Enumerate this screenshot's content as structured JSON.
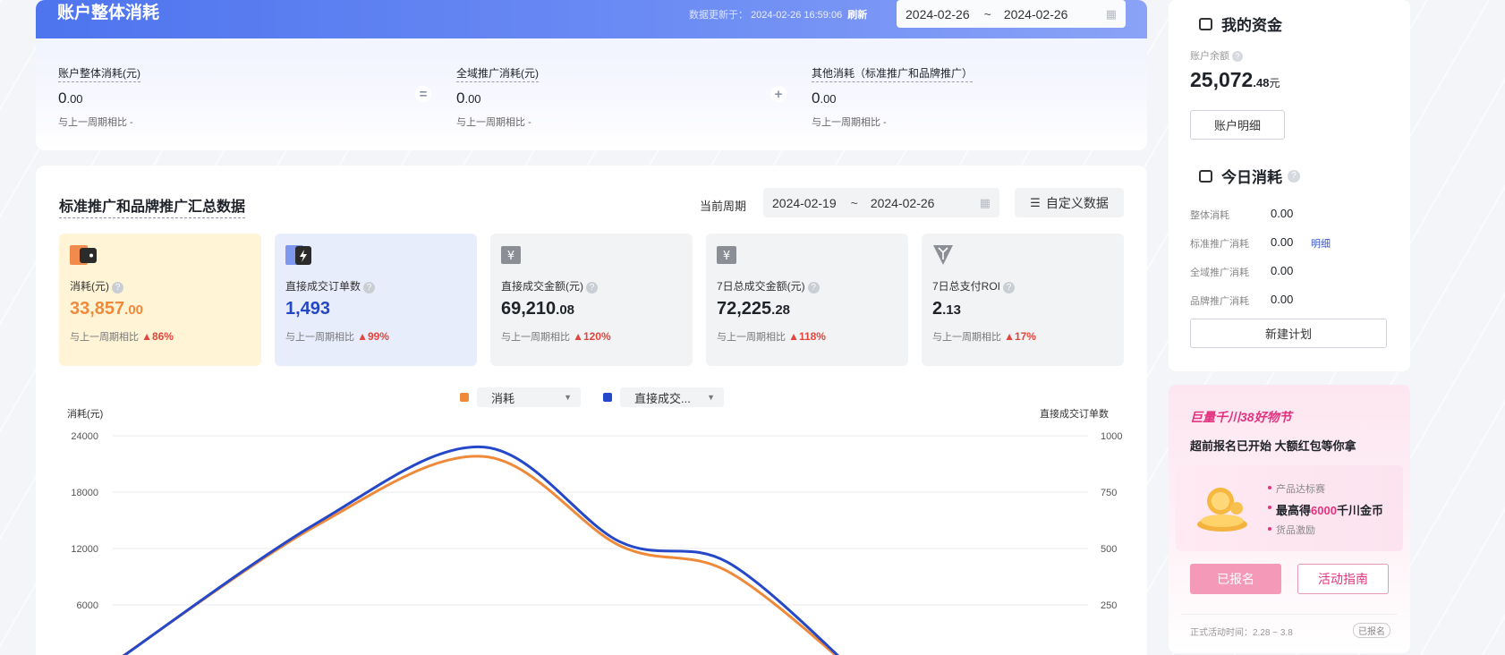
{
  "overall": {
    "title": "账户整体消耗",
    "update_prefix": "数据更新于：",
    "update_time": "2024-02-26 16:59:06",
    "refresh_label": "刷新",
    "date_start": "2024-02-26",
    "date_sep": "~",
    "date_end": "2024-02-26",
    "equals_op": "=",
    "plus_op": "+",
    "metrics": [
      {
        "label": "账户整体消耗(元)",
        "int": "0",
        "dec": ".00",
        "compare": "与上一周期相比 -"
      },
      {
        "label": "全域推广消耗(元)",
        "int": "0",
        "dec": ".00",
        "compare": "与上一周期相比 -"
      },
      {
        "label": "其他消耗（标准推广和品牌推广）",
        "int": "0",
        "dec": ".00",
        "compare": "与上一周期相比 -"
      }
    ]
  },
  "summary": {
    "title": "标准推广和品牌推广汇总数据",
    "period_label": "当前周期",
    "date_start": "2024-02-19",
    "date_sep": "~",
    "date_end": "2024-02-26",
    "custom_label": "自定义数据",
    "kpis": [
      {
        "label": "消耗(元)",
        "int": "33,857",
        "dec": ".00",
        "compare": "与上一周期相比",
        "change": "▲86%"
      },
      {
        "label": "直接成交订单数",
        "int": "1,493",
        "dec": "",
        "compare": "与上一周期相比",
        "change": "▲99%"
      },
      {
        "label": "直接成交金额(元)",
        "int": "69,210",
        "dec": ".08",
        "compare": "与上一周期相比",
        "change": "▲120%"
      },
      {
        "label": "7日总成交金额(元)",
        "int": "72,225",
        "dec": ".28",
        "compare": "与上一周期相比",
        "change": "▲118%"
      },
      {
        "label": "7日总支付ROI",
        "int": "2",
        "dec": ".13",
        "compare": "与上一周期相比",
        "change": "▲17%"
      }
    ],
    "legend": [
      {
        "label": "消耗",
        "color": "#ef8a3a"
      },
      {
        "label": "直接成交...",
        "color": "#2548c9"
      }
    ]
  },
  "chart_data": {
    "type": "line",
    "left_axis_label": "消耗(元)",
    "right_axis_label": "直接成交订单数",
    "left_ticks": [
      "24000",
      "18000",
      "12000",
      "6000"
    ],
    "right_ticks": [
      "1000",
      "750",
      "500",
      "250"
    ],
    "left_ylim": [
      0,
      24000
    ],
    "right_ylim": [
      0,
      1000
    ],
    "grid": true,
    "series": [
      {
        "name": "消耗",
        "axis": "left",
        "color": "#ef8a3a",
        "points": [
          [
            0,
            -200
          ],
          [
            0.21,
            14500
          ],
          [
            0.38,
            21800
          ],
          [
            0.52,
            12300
          ],
          [
            0.63,
            9600
          ],
          [
            0.76,
            -1000
          ]
        ]
      },
      {
        "name": "直接成交...",
        "axis": "right",
        "color": "#2548c9",
        "points": [
          [
            0,
            -10
          ],
          [
            0.21,
            615
          ],
          [
            0.38,
            950
          ],
          [
            0.52,
            530
          ],
          [
            0.63,
            440
          ],
          [
            0.76,
            -40
          ]
        ]
      }
    ]
  },
  "sidebar": {
    "funds_title": "我的资金",
    "balance_label": "账户余额",
    "balance_int": "25,072",
    "balance_dec": ".48",
    "balance_unit": "元",
    "account_detail_btn": "账户明细",
    "today_title": "今日消耗",
    "today_rows": [
      {
        "label": "整体消耗",
        "value": "0.00"
      },
      {
        "label": "标准推广消耗",
        "value": "0.00",
        "link": "明细"
      },
      {
        "label": "全域推广消耗",
        "value": "0.00"
      },
      {
        "label": "品牌推广消耗",
        "value": "0.00"
      }
    ],
    "new_plan_btn": "新建计划"
  },
  "promo": {
    "title": "巨量千川38好物节",
    "subtitle": "超前报名已开始 大额红包等你拿",
    "bullet1": "产品达标赛",
    "bullet2_prefix": "最高得",
    "bullet2_highlight": "6000",
    "bullet2_suffix": "千川金币",
    "bullet3": "货品激励",
    "registered_btn": "已报名",
    "guide_btn": "活动指南",
    "footer": "正式活动时间：2.28 ~ 3.8",
    "footer_tag": "已报名"
  }
}
